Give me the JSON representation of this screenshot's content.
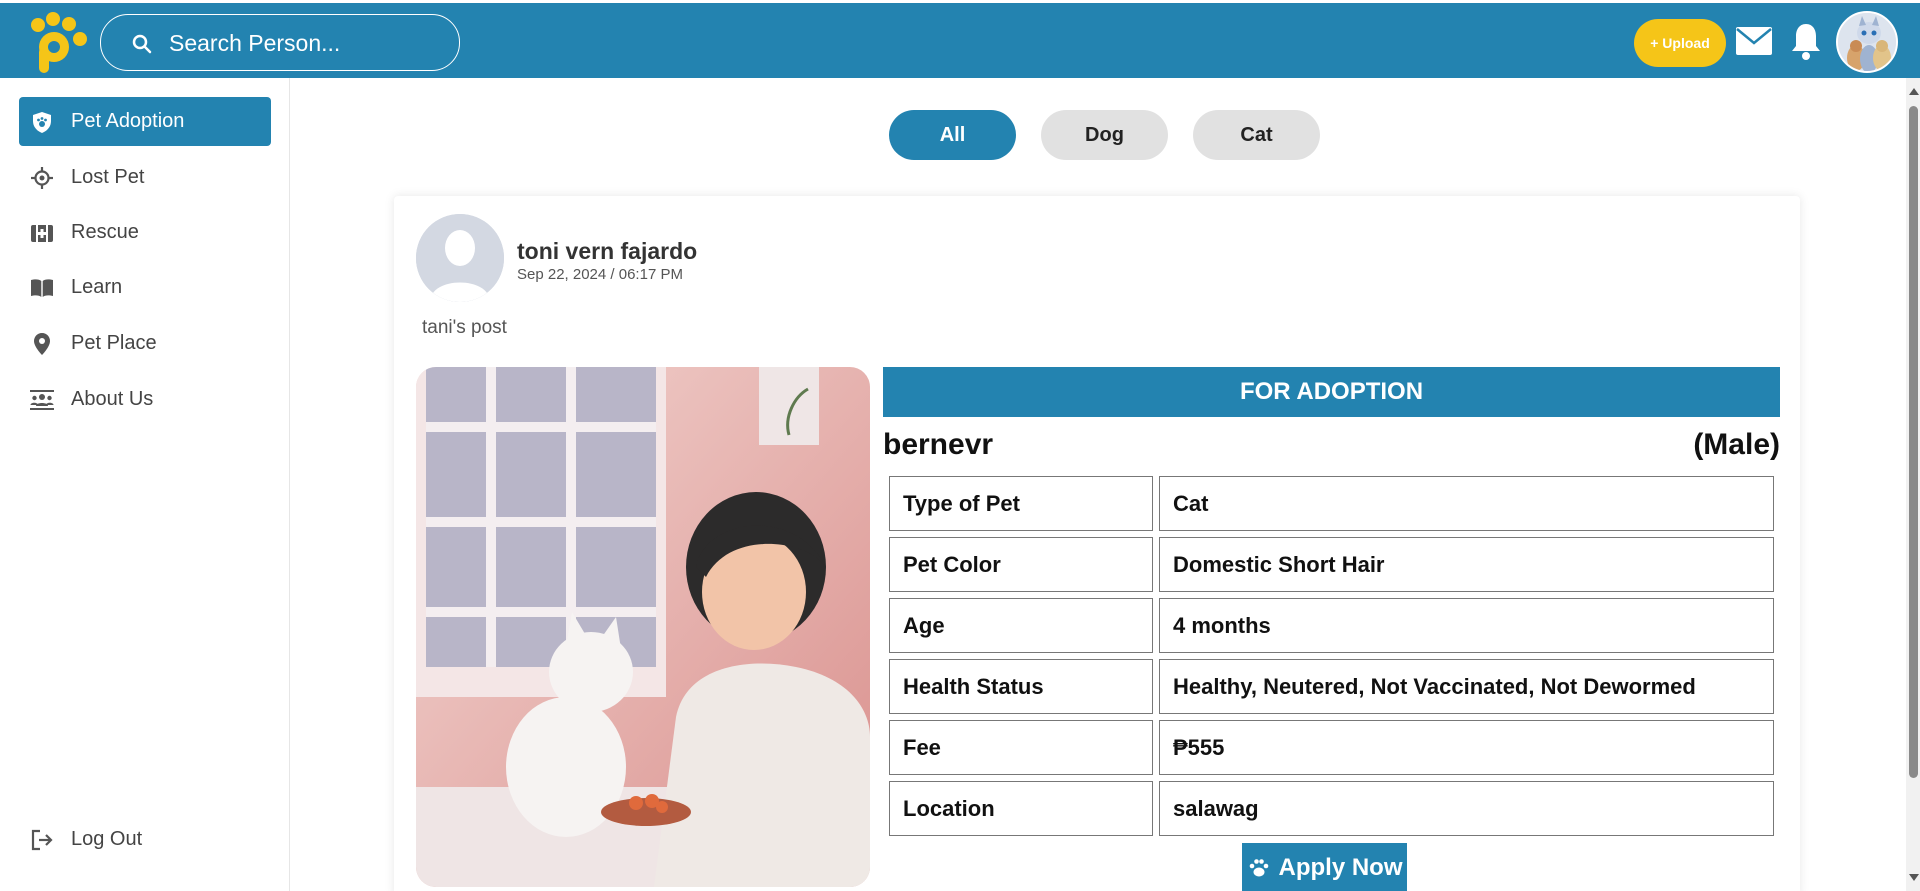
{
  "colors": {
    "brand": "#2383b0",
    "accent": "#f5c518"
  },
  "header": {
    "logo_icon": "paw-p-logo",
    "search_placeholder": "Search Person...",
    "upload_label": "+ Upload",
    "icons": [
      "search-icon",
      "mail-icon",
      "bell-icon",
      "avatar"
    ]
  },
  "sidebar": {
    "items": [
      {
        "label": "Pet Adoption",
        "icon": "shield-paw-icon",
        "active": true
      },
      {
        "label": "Lost Pet",
        "icon": "locate-icon"
      },
      {
        "label": "Rescue",
        "icon": "medical-kit-icon"
      },
      {
        "label": "Learn",
        "icon": "book-icon"
      },
      {
        "label": "Pet Place",
        "icon": "map-pin-icon"
      },
      {
        "label": "About Us",
        "icon": "group-icon"
      }
    ],
    "logout": {
      "label": "Log Out",
      "icon": "logout-icon"
    }
  },
  "tabs": [
    {
      "label": "All",
      "active": true
    },
    {
      "label": "Dog"
    },
    {
      "label": "Cat"
    }
  ],
  "post": {
    "author": "toni vern fajardo",
    "date": "Sep 22, 2024 / 06:17 PM",
    "text": "tani's post",
    "status_header": "FOR ADOPTION",
    "pet_name": "bernevr",
    "pet_gender": "(Male)",
    "details": [
      {
        "label": "Type of Pet",
        "value": "Cat"
      },
      {
        "label": "Pet Color",
        "value": "Domestic Short Hair"
      },
      {
        "label": "Age",
        "value": "4 months"
      },
      {
        "label": "Health Status",
        "value": "Healthy, Neutered, Not Vaccinated, Not Dewormed"
      },
      {
        "label": "Fee",
        "value": "₱555"
      },
      {
        "label": "Location",
        "value": "salawag"
      }
    ],
    "apply_label": "Apply Now"
  }
}
